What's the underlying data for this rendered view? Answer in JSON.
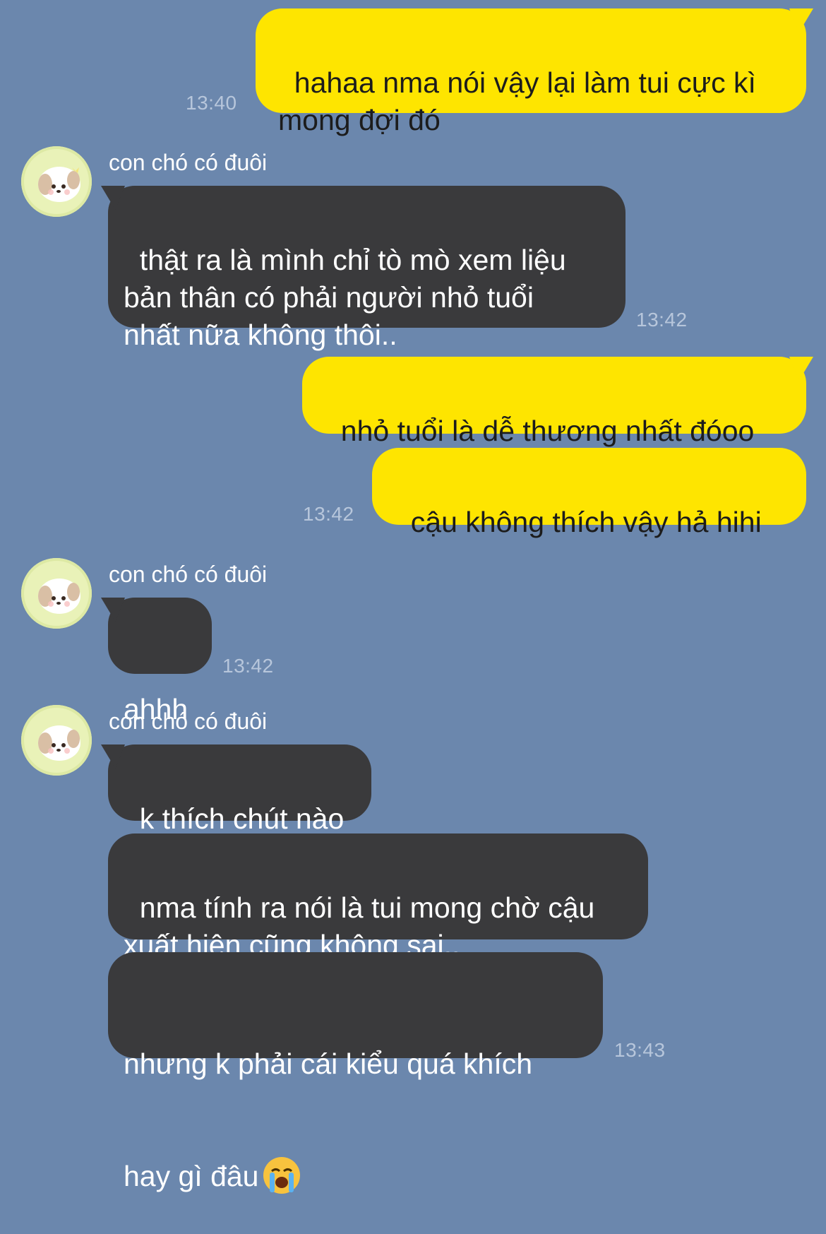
{
  "colors": {
    "background": "#6b87ad",
    "my_bubble": "#fee500",
    "their_bubble": "#3a3a3c",
    "timestamp": "#b7c6db",
    "avatar_bg": "#e9f2b8"
  },
  "messages": {
    "m1": {
      "text": "hahaa nma nói vậy lại làm tui cực kì\nmong đợi đó",
      "time": "13:40"
    },
    "group1": {
      "sender": "con chó có đuôi",
      "avatar_icon": "puppy-avatar-icon",
      "m2": {
        "text": "thật ra là mình chỉ tò mò xem liệu\nbản thân có phải người nhỏ tuổi\nnhất nữa không thôi..",
        "time": "13:42"
      }
    },
    "m3": {
      "text": "nhỏ tuổi là dễ thương nhất đóoo"
    },
    "m4": {
      "text": "cậu không thích vậy hả hihi",
      "time": "13:42"
    },
    "group2": {
      "sender": "con chó có đuôi",
      "avatar_icon": "puppy-avatar-icon",
      "m5": {
        "text": "ahhh",
        "time": "13:42"
      }
    },
    "group3": {
      "sender": "con chó có đuôi",
      "avatar_icon": "puppy-avatar-icon",
      "m6": {
        "text": "k thích chút nào"
      },
      "m7": {
        "text": "nma tính ra nói là tui mong chờ cậu\nxuất hiện cũng không sai.."
      },
      "m8": {
        "line1": "nhưng k phải cái kiểu quá khích",
        "line2": "hay gì đâu",
        "emoji": "loudly-crying-face-emoji",
        "time": "13:43"
      }
    }
  }
}
